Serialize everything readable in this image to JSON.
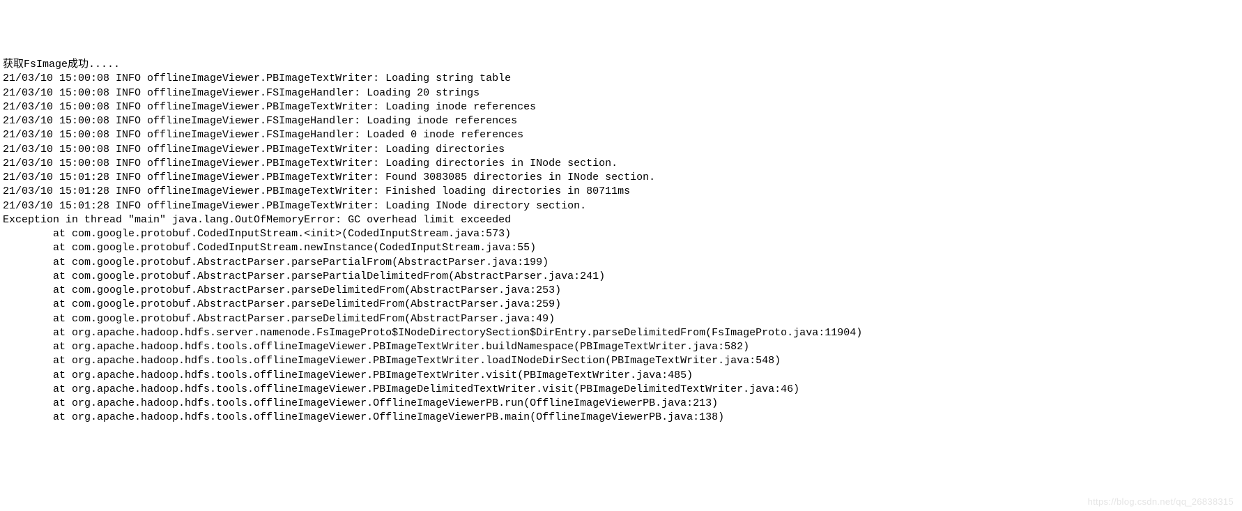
{
  "lines": [
    "获取FsImage成功.....",
    "21/03/10 15:00:08 INFO offlineImageViewer.PBImageTextWriter: Loading string table",
    "21/03/10 15:00:08 INFO offlineImageViewer.FSImageHandler: Loading 20 strings",
    "21/03/10 15:00:08 INFO offlineImageViewer.PBImageTextWriter: Loading inode references",
    "21/03/10 15:00:08 INFO offlineImageViewer.FSImageHandler: Loading inode references",
    "21/03/10 15:00:08 INFO offlineImageViewer.FSImageHandler: Loaded 0 inode references",
    "21/03/10 15:00:08 INFO offlineImageViewer.PBImageTextWriter: Loading directories",
    "21/03/10 15:00:08 INFO offlineImageViewer.PBImageTextWriter: Loading directories in INode section.",
    "21/03/10 15:01:28 INFO offlineImageViewer.PBImageTextWriter: Found 3083085 directories in INode section.",
    "21/03/10 15:01:28 INFO offlineImageViewer.PBImageTextWriter: Finished loading directories in 80711ms",
    "21/03/10 15:01:28 INFO offlineImageViewer.PBImageTextWriter: Loading INode directory section.",
    "Exception in thread \"main\" java.lang.OutOfMemoryError: GC overhead limit exceeded",
    "        at com.google.protobuf.CodedInputStream.<init>(CodedInputStream.java:573)",
    "        at com.google.protobuf.CodedInputStream.newInstance(CodedInputStream.java:55)",
    "        at com.google.protobuf.AbstractParser.parsePartialFrom(AbstractParser.java:199)",
    "        at com.google.protobuf.AbstractParser.parsePartialDelimitedFrom(AbstractParser.java:241)",
    "        at com.google.protobuf.AbstractParser.parseDelimitedFrom(AbstractParser.java:253)",
    "        at com.google.protobuf.AbstractParser.parseDelimitedFrom(AbstractParser.java:259)",
    "        at com.google.protobuf.AbstractParser.parseDelimitedFrom(AbstractParser.java:49)",
    "        at org.apache.hadoop.hdfs.server.namenode.FsImageProto$INodeDirectorySection$DirEntry.parseDelimitedFrom(FsImageProto.java:11904)",
    "        at org.apache.hadoop.hdfs.tools.offlineImageViewer.PBImageTextWriter.buildNamespace(PBImageTextWriter.java:582)",
    "        at org.apache.hadoop.hdfs.tools.offlineImageViewer.PBImageTextWriter.loadINodeDirSection(PBImageTextWriter.java:548)",
    "        at org.apache.hadoop.hdfs.tools.offlineImageViewer.PBImageTextWriter.visit(PBImageTextWriter.java:485)",
    "        at org.apache.hadoop.hdfs.tools.offlineImageViewer.PBImageDelimitedTextWriter.visit(PBImageDelimitedTextWriter.java:46)",
    "        at org.apache.hadoop.hdfs.tools.offlineImageViewer.OfflineImageViewerPB.run(OfflineImageViewerPB.java:213)",
    "        at org.apache.hadoop.hdfs.tools.offlineImageViewer.OfflineImageViewerPB.main(OfflineImageViewerPB.java:138)"
  ],
  "watermark": "https://blog.csdn.net/qq_26838315"
}
